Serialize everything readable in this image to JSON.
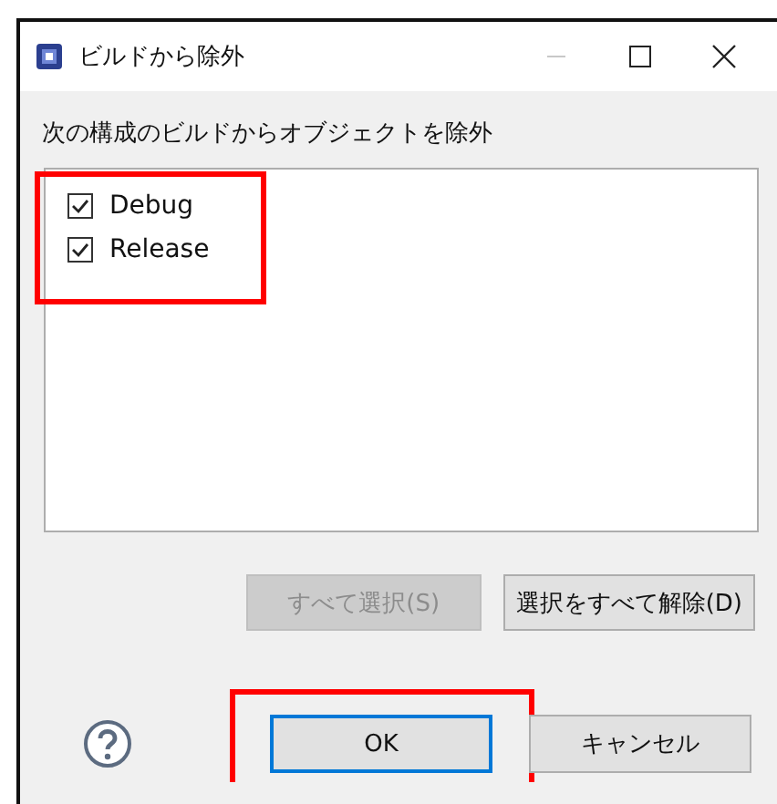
{
  "window": {
    "title": "ビルドから除外"
  },
  "prompt": "次の構成のビルドからオブジェクトを除外",
  "configurations": {
    "highlighted": true,
    "items": [
      {
        "label": "Debug",
        "checked": true
      },
      {
        "label": "Release",
        "checked": true
      }
    ]
  },
  "selection_buttons": [
    {
      "label": "すべて選択(S)",
      "disabled": true
    },
    {
      "label": "選択をすべて解除(D)",
      "disabled": false
    }
  ],
  "dialog_buttons": [
    {
      "label": "OK",
      "default": true,
      "highlighted": true
    },
    {
      "label": "キャンセル",
      "default": false,
      "highlighted": false
    }
  ]
}
